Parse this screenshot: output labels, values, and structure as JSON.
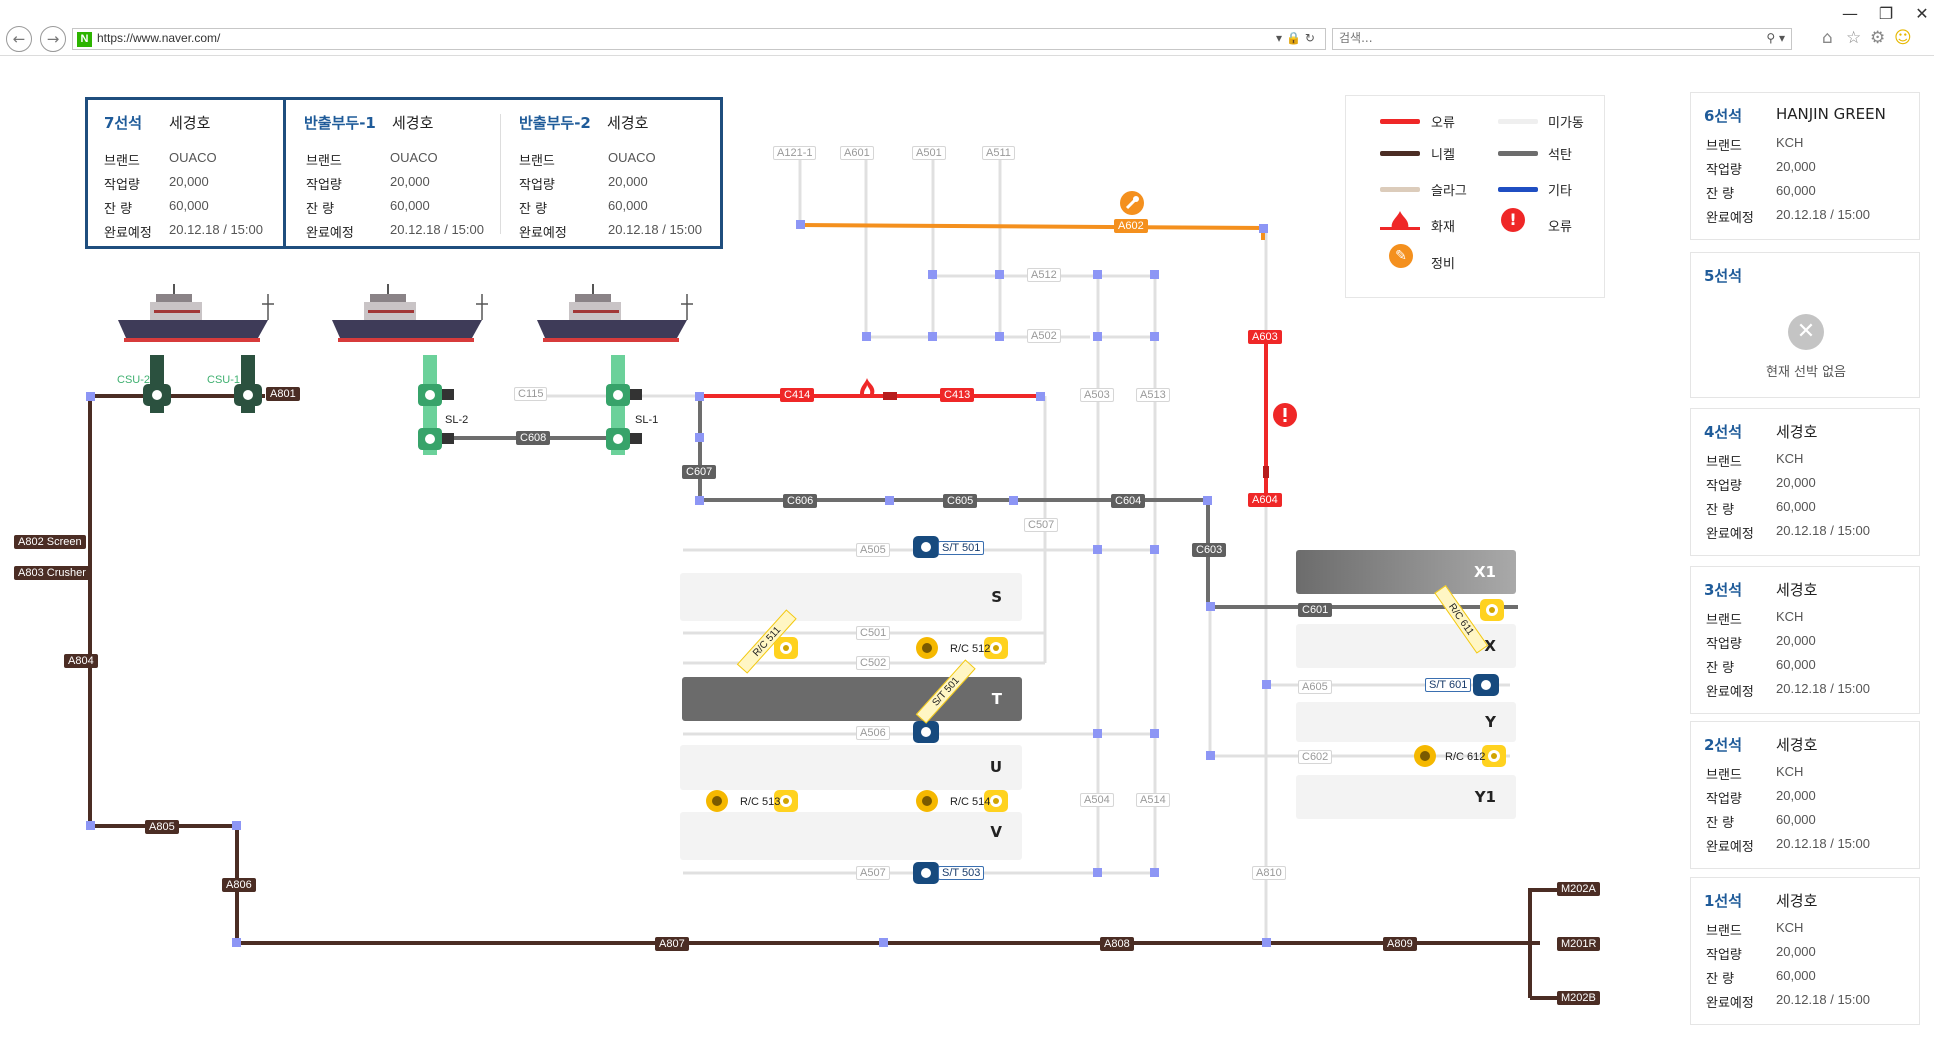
{
  "browser": {
    "url": "https://www.naver.com/",
    "search_placeholder": "검색..."
  },
  "berth_info": {
    "berth7": {
      "title": "7선석",
      "ship": "세경호",
      "brand": "OUACO",
      "work": "20,000",
      "remain": "60,000",
      "eta": "20.12.18 / 15:00"
    },
    "out1": {
      "title": "반출부두-1",
      "ship": "세경호",
      "brand": "OUACO",
      "work": "20,000",
      "remain": "60,000",
      "eta": "20.12.18 / 15:00"
    },
    "out2": {
      "title": "반출부두-2",
      "ship": "세경호",
      "brand": "OUACO",
      "work": "20,000",
      "remain": "60,000",
      "eta": "20.12.18 / 15:00"
    },
    "labels": {
      "brand": "브랜드",
      "work": "작업량",
      "remain": "잔  량",
      "eta": "완료예정"
    }
  },
  "legend": {
    "error_line": "오류",
    "idle_line": "미가동",
    "nickel": "니켈",
    "coal": "석탄",
    "slag": "슬라그",
    "other": "기타",
    "fire": "화재",
    "error": "오류",
    "maint": "정비",
    "colors": {
      "error": "#ef2727",
      "idle": "#efefef",
      "nickel": "#4b2d24",
      "coal": "#6d6d6d",
      "slag": "#dcccbb",
      "other": "#1f4ec2",
      "maint": "#f4901e"
    }
  },
  "cards": [
    {
      "title": "6선석",
      "ship": "HANJIN GREEN",
      "brand": "KCH",
      "work": "20,000",
      "remain": "60,000",
      "eta": "20.12.18 / 15:00"
    },
    {
      "title": "5선석",
      "empty": "현재 선박 없음"
    },
    {
      "title": "4선석",
      "ship": "세경호",
      "brand": "KCH",
      "work": "20,000",
      "remain": "60,000",
      "eta": "20.12.18 / 15:00"
    },
    {
      "title": "3선석",
      "ship": "세경호",
      "brand": "KCH",
      "work": "20,000",
      "remain": "60,000",
      "eta": "20.12.18 / 15:00"
    },
    {
      "title": "2선석",
      "ship": "세경호",
      "brand": "KCH",
      "work": "20,000",
      "remain": "60,000",
      "eta": "20.12.18 / 15:00"
    },
    {
      "title": "1선석",
      "ship": "세경호",
      "brand": "KCH",
      "work": "20,000",
      "remain": "60,000",
      "eta": "20.12.18 / 15:00"
    }
  ],
  "card_labels": {
    "brand": "브랜드",
    "work": "작업량",
    "remain": "잔  량",
    "eta": "완료예정"
  },
  "yards": {
    "S": "S",
    "T": "T",
    "U": "U",
    "V": "V",
    "X1": "X1",
    "X": "X",
    "Y": "Y",
    "Y1": "Y1"
  },
  "equipment": {
    "csu2": "CSU-2",
    "csu1": "CSU-1",
    "sl2": "SL-2",
    "sl1": "SL-1",
    "st501": "S/T 501",
    "st601": "S/T 601",
    "st503": "S/T 503",
    "st501b": "S/T 501",
    "rc512": "R/C 512",
    "rc511": "R/C 511",
    "rc513": "R/C 513",
    "rc514": "R/C 514",
    "rc611": "R/C 611",
    "rc612": "R/C 612"
  },
  "conveyors": {
    "A121_1": "A121-1",
    "A601": "A601",
    "A501": "A501",
    "A511": "A511",
    "A602": "A602",
    "A512": "A512",
    "A502": "A502",
    "A603": "A603",
    "A604": "A604",
    "A801": "A801",
    "C115": "C115",
    "C414": "C414",
    "C413": "C413",
    "A503": "A503",
    "A513": "A513",
    "C608": "C608",
    "C607": "C607",
    "C606": "C606",
    "C605": "C605",
    "C604": "C604",
    "C507": "C507",
    "C603": "C603",
    "A505": "A505",
    "C601": "C601",
    "C501": "C501",
    "C502": "C502",
    "A605": "A605",
    "A506": "A506",
    "C602": "C602",
    "A504": "A504",
    "A514": "A514",
    "A507": "A507",
    "A810": "A810",
    "A802": "A802 Screen",
    "A803": "A803 Crusher",
    "A804": "A804",
    "A805": "A805",
    "A806": "A806",
    "A807": "A807",
    "A808": "A808",
    "A809": "A809",
    "M202A": "M202A",
    "M201R": "M201R",
    "M202B": "M202B"
  }
}
